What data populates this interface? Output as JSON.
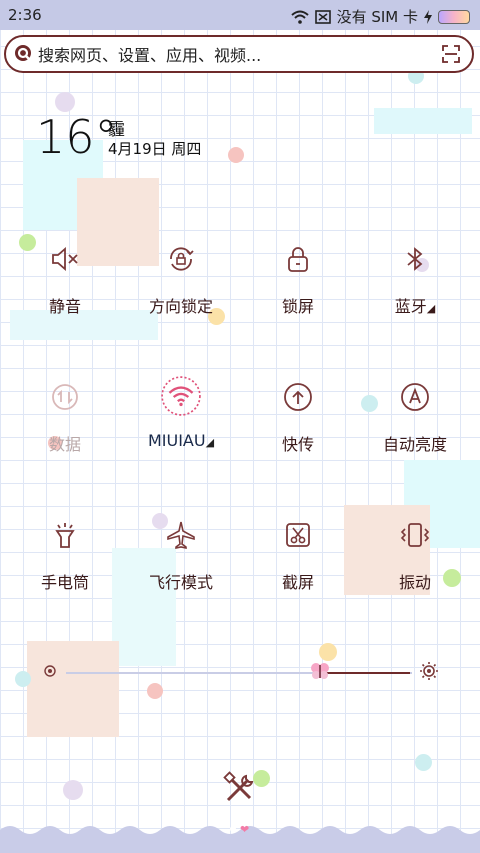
{
  "statusbar": {
    "time": "2:36",
    "carrier": "没有 SIM 卡"
  },
  "search": {
    "placeholder": "搜索网页、设置、应用、视频..."
  },
  "weather": {
    "temperature": "16°",
    "condition": "霾",
    "date": "4月19日 周四"
  },
  "tiles": [
    {
      "label": "静音",
      "icon": "mute-icon"
    },
    {
      "label": "方向锁定",
      "icon": "rotation-lock-icon"
    },
    {
      "label": "锁屏",
      "icon": "lock-icon"
    },
    {
      "label": "蓝牙",
      "icon": "bluetooth-icon"
    },
    {
      "label": "数据",
      "icon": "data-icon"
    },
    {
      "label": "MIUIAU",
      "icon": "wifi-icon"
    },
    {
      "label": "快传",
      "icon": "share-icon"
    },
    {
      "label": "自动亮度",
      "icon": "auto-brightness-icon"
    },
    {
      "label": "手电筒",
      "icon": "flashlight-icon"
    },
    {
      "label": "飞行模式",
      "icon": "airplane-icon"
    },
    {
      "label": "截屏",
      "icon": "screenshot-icon"
    },
    {
      "label": "振动",
      "icon": "vibrate-icon"
    }
  ],
  "brightness": {
    "level": 0.74
  },
  "colors": {
    "accent": "#6e2a2a",
    "wifi_active": "#e0527a",
    "statusbar": "#c5c9e6"
  }
}
